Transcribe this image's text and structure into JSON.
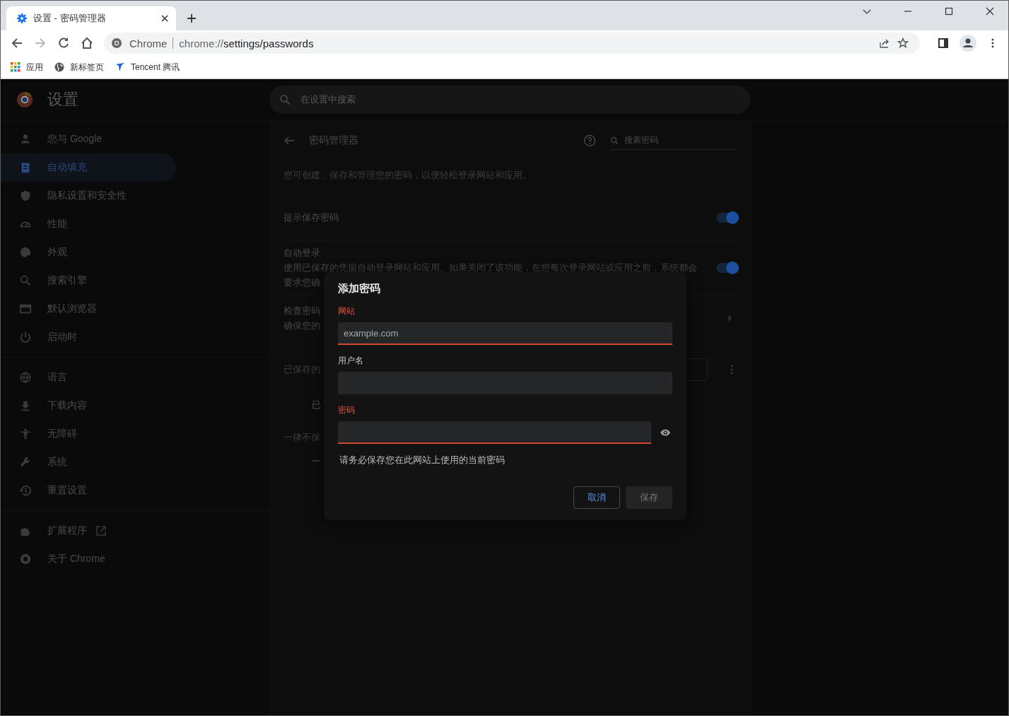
{
  "browser": {
    "tab": {
      "title": "设置 - 密码管理器",
      "selected": true
    },
    "address": {
      "site": "Chrome",
      "url_host": "chrome://",
      "url_path": "settings/passwords"
    },
    "bookmarks": [
      "应用",
      "新标签页",
      "Tencent 腾讯"
    ]
  },
  "settings_header": {
    "title": "设置",
    "search_placeholder": "在设置中搜索"
  },
  "sidebar": {
    "groups": [
      {
        "items": [
          {
            "label": "您与 Google",
            "selected": false
          },
          {
            "label": "自动填充",
            "selected": true
          },
          {
            "label": "隐私设置和安全性",
            "selected": false
          },
          {
            "label": "性能",
            "selected": false
          },
          {
            "label": "外观",
            "selected": false
          },
          {
            "label": "搜索引擎",
            "selected": false
          },
          {
            "label": "默认浏览器",
            "selected": false
          },
          {
            "label": "启动时",
            "selected": false
          }
        ]
      },
      {
        "items": [
          {
            "label": "语言",
            "selected": false
          },
          {
            "label": "下载内容",
            "selected": false
          },
          {
            "label": "无障碍",
            "selected": false
          },
          {
            "label": "系统",
            "selected": false
          },
          {
            "label": "重置设置",
            "selected": false
          }
        ]
      },
      {
        "items": [
          {
            "label": "扩展程序",
            "selected": false
          },
          {
            "label": "关于 Chrome",
            "selected": false
          }
        ]
      }
    ]
  },
  "page": {
    "title": "密码管理器",
    "search_placeholder": "搜索密码",
    "intro": "您可创建、保存和管理您的密码，以便轻松登录网站和应用。",
    "settings": [
      {
        "title": "提示保存密码",
        "on": true
      },
      {
        "title": "自动登录",
        "description": "使用已保存的凭据自动登录网站和应用。如果关闭了该功能，在您每次登录网站或应用之前，系统都会",
        "description_2": "要求您确",
        "on": true
      }
    ],
    "check": {
      "title": "检查密码",
      "description": "确保您的"
    },
    "saved_heading": "已保存的",
    "saved_empty": "已",
    "never_heading": "一律不保",
    "never_empty": "一"
  },
  "dialog": {
    "title": "添加密码",
    "fields": [
      {
        "label": "网站",
        "placeholder": "example.com",
        "error": true,
        "kind": "text"
      },
      {
        "label": "用户名",
        "error": false,
        "kind": "text"
      },
      {
        "label": "密码",
        "error": true,
        "kind": "password"
      }
    ],
    "hint": "请务必保存您在此网站上使用的当前密码",
    "buttons": [
      {
        "label": "取消",
        "kind": "outline"
      },
      {
        "label": "保存",
        "kind": "disabled"
      }
    ]
  }
}
